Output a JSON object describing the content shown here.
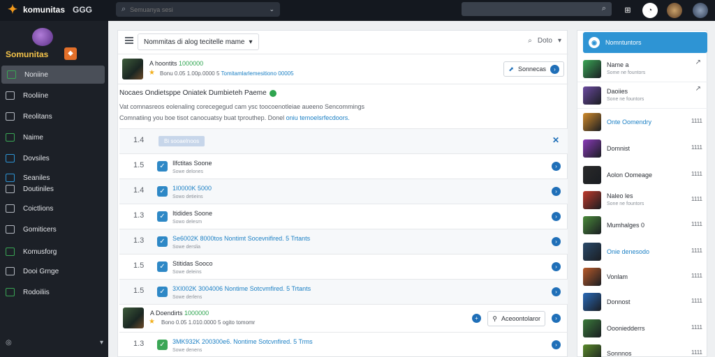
{
  "topbar": {
    "brand": "komunitas",
    "brand_suffix": "GGG",
    "search_placeholder": "Semuanya sesi"
  },
  "sidebar": {
    "logo_text": "Somunitas",
    "items": [
      {
        "label": "Noniine",
        "color": "#3aa655"
      },
      {
        "label": "Rooliine",
        "color": "#b5bac2"
      },
      {
        "label": "Reolitans",
        "color": "#b5bac2"
      },
      {
        "label": "Naime",
        "color": "#3aa655"
      },
      {
        "label": "Dovsiles",
        "color": "#2e94d4"
      },
      {
        "label": "Seaniles",
        "color": "#2e94d4"
      },
      {
        "label": "Doutiniles",
        "color": "#b5bac2"
      },
      {
        "label": "Coictlions",
        "color": "#b5bac2"
      },
      {
        "label": "Gomiticers",
        "color": "#b5bac2"
      },
      {
        "label": "Komusforg",
        "color": "#3aa655"
      },
      {
        "label": "Dooi Grnge",
        "color": "#b5bac2"
      },
      {
        "label": "Rodoiliis",
        "color": "#3aa655"
      }
    ]
  },
  "main": {
    "filter_label": "Nommitas di alog tecitelle mame",
    "header_right": "Doto",
    "posts": [
      {
        "name": "A hoontits",
        "green": "1000000",
        "sub": "Bonu 0.05 1.00p.0000 5",
        "sub_link": "Tomitamlarlemesitiono 00005",
        "button": "Sonnecas"
      },
      {
        "name": "A Doendirts",
        "green": "1000000",
        "sub": "Bono 0.05 1.010.0000 5",
        "sub_link": "ogito tomomr",
        "button": "Aceoontolaror"
      }
    ],
    "section_title": "Nocaes Ondietsppe Oniatek Dumbieteh Paeme",
    "desc_line1": "Vat comnasreos eolenaling corecegegud cam ysc toocoenotleiae aueeno Sencommings",
    "desc_line2": "Comnatiing you boe tisot canocuatsy buat tprouthep. Donel",
    "desc_line2_link": "oniu temoelsrfecdoors.",
    "list_header": {
      "num": "1.4",
      "chip": "Bi sooaelnoos"
    },
    "rows": [
      {
        "num": "1.5",
        "title": "Ilfctitas Soone",
        "meta": "Sowe delones",
        "link": false
      },
      {
        "num": "1.4",
        "title": "1I0000K 5000",
        "meta": "Sowo detieins",
        "link": true
      },
      {
        "num": "1.3",
        "title": "Itidides Soone",
        "meta": "Sowo delesm",
        "link": false
      },
      {
        "num": "1.3",
        "title": "Se6002K 8000tos  Nontimt Socevnifired. 5 Trtants",
        "meta": "Sowe derslia",
        "link": true
      },
      {
        "num": "1.5",
        "title": "Stitidas Sooco",
        "meta": "Sowe deleins",
        "link": false
      },
      {
        "num": "1.5",
        "title": "3XI002K 3004006  Nontime Sotcvmfired. 5 Trtants",
        "meta": "Sowe derlens",
        "link": true
      },
      {
        "num": "1.3",
        "title": "3MK932K 200300e6. Nontime Sotcvnfired. 5 Trms",
        "meta": "Sowe denens",
        "link": true
      }
    ]
  },
  "right_panel": {
    "title": "Nomntuntors",
    "items": [
      {
        "title": "Name a",
        "sub": "Some ne fountors",
        "time": "",
        "link": false,
        "thumb": "#3aa655",
        "more": true
      },
      {
        "title": "Daoiies",
        "sub": "Sone ne fountors",
        "time": "",
        "link": false,
        "thumb": "#6b4aa0",
        "more": true
      },
      {
        "title": "Onte Oomendry",
        "sub": "",
        "time": "1111",
        "link": true,
        "thumb": "#d08a2a"
      },
      {
        "title": "Domnist",
        "sub": "",
        "time": "1111",
        "link": false,
        "thumb": "#8a3ab8"
      },
      {
        "title": "Aolon Oomeage",
        "sub": "",
        "time": "1111",
        "link": false,
        "thumb": "#2a2a2a"
      },
      {
        "title": "Naleo les",
        "sub": "Sone ne fountors",
        "time": "1111",
        "link": false,
        "thumb": "#c0392b"
      },
      {
        "title": "Mumhalges 0",
        "sub": "",
        "time": "1111",
        "link": false,
        "thumb": "#4a8a3a"
      },
      {
        "title": "Onie denesodo",
        "sub": "",
        "time": "1111",
        "link": true,
        "thumb": "#2a4a6a"
      },
      {
        "title": "Vonlam",
        "sub": "",
        "time": "1111",
        "link": false,
        "thumb": "#b85a2a"
      },
      {
        "title": "Donnost",
        "sub": "",
        "time": "1111",
        "link": false,
        "thumb": "#2a6ab8"
      },
      {
        "title": "Oooniedderrs",
        "sub": "",
        "time": "1111",
        "link": false,
        "thumb": "#3a7a3a"
      },
      {
        "title": "Sonnnos",
        "sub": "",
        "time": "1111",
        "link": false,
        "thumb": "#5a8a2a"
      }
    ]
  }
}
